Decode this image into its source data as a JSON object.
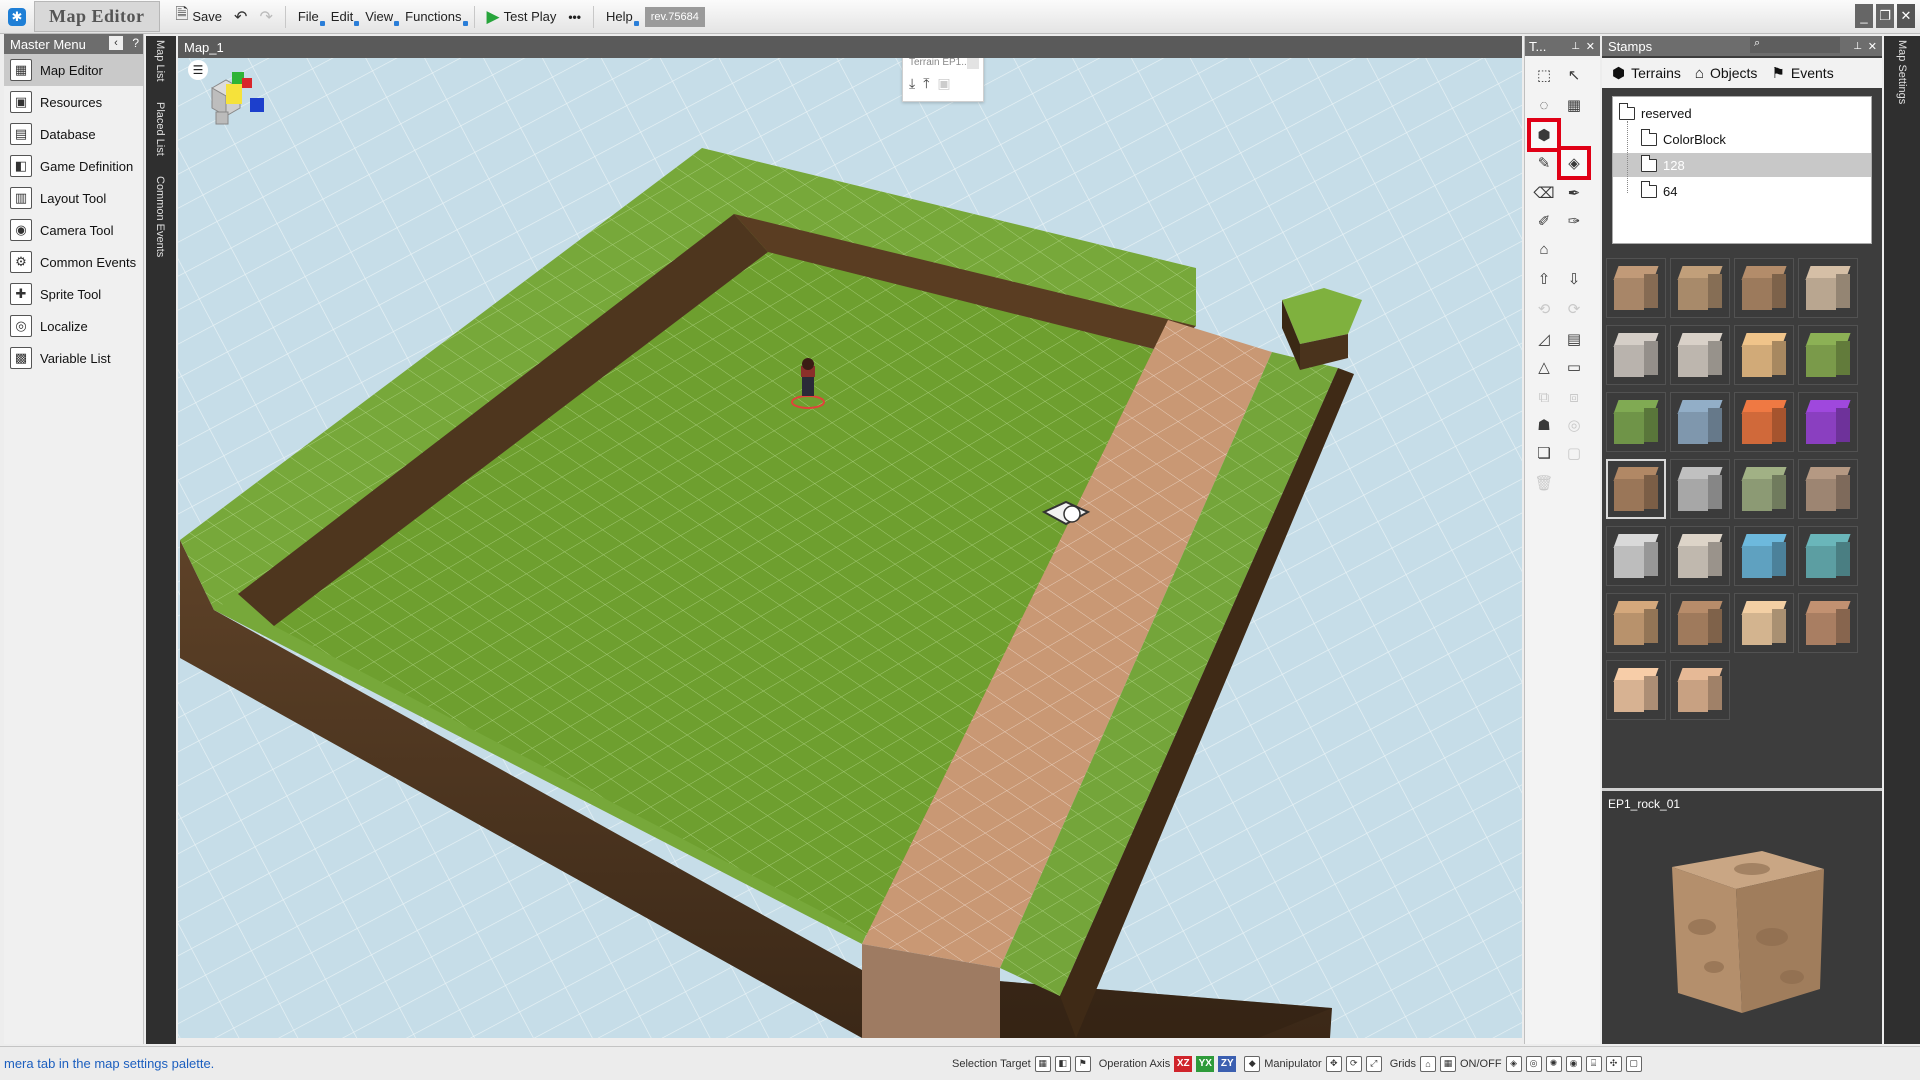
{
  "titlebar": {
    "app_title": "Map Editor",
    "save_label": "Save",
    "menus": [
      "File",
      "Edit",
      "View",
      "Functions"
    ],
    "test_play_label": "Test Play",
    "more_label": "•••",
    "help_label": "Help",
    "revision": "rev.75684"
  },
  "master_menu": {
    "title": "Master Menu",
    "help_label": "?",
    "items": [
      {
        "label": "Map Editor",
        "icon": "map-icon",
        "active": true
      },
      {
        "label": "Resources",
        "icon": "resources-icon"
      },
      {
        "label": "Database",
        "icon": "database-icon"
      },
      {
        "label": "Game Definition",
        "icon": "game-definition-icon"
      },
      {
        "label": "Layout Tool",
        "icon": "layout-icon"
      },
      {
        "label": "Camera Tool",
        "icon": "camera-icon"
      },
      {
        "label": "Common Events",
        "icon": "events-icon"
      },
      {
        "label": "Sprite Tool",
        "icon": "sprite-icon"
      },
      {
        "label": "Localize",
        "icon": "localize-icon"
      },
      {
        "label": "Variable List",
        "icon": "variable-icon"
      }
    ]
  },
  "side_tabs": [
    "Map List",
    "Placed List",
    "Common Events"
  ],
  "viewport": {
    "tab_label": "Map_1",
    "terrain_popup_title": "Terrain EP1..."
  },
  "tools_panel": {
    "title": "T...",
    "pin": "📌",
    "close": "✕"
  },
  "stamps": {
    "title": "Stamps",
    "tabs": [
      {
        "label": "Terrains",
        "icon": "terrain-icon"
      },
      {
        "label": "Objects",
        "icon": "objects-icon"
      },
      {
        "label": "Events",
        "icon": "events-icon"
      }
    ],
    "tree": [
      {
        "label": "reserved",
        "level": 0
      },
      {
        "label": "ColorBlock",
        "level": 1
      },
      {
        "label": "128",
        "level": 1,
        "selected": true
      },
      {
        "label": "64",
        "level": 1
      }
    ],
    "preview_name": "EP1_rock_01",
    "swatches": [
      "#a88668",
      "#a88a6a",
      "#9c7a5c",
      "#b9a690",
      "#b9b3ad",
      "#bdb6ae",
      "#d1aa78",
      "#7a9a4a",
      "#6f9448",
      "#7f97ad",
      "#d0693a",
      "#8a3fc0",
      "#9a7658",
      "#a7a7a7",
      "#8c9a74",
      "#9d8572",
      "#bdbdbd",
      "#c0b8ae",
      "#5fa1c0",
      "#5c9ea2",
      "#b8926c",
      "#9f7a5c",
      "#d3b48f",
      "#a97e62",
      "#d7b292",
      "#c8a182"
    ],
    "selected_swatch": 12
  },
  "right_strip_label": "Map Settings",
  "statusbar": {
    "message": "mera tab in the map settings palette.",
    "selection_target_label": "Selection Target",
    "operation_axis_label": "Operation Axis",
    "axes": [
      {
        "label": "XZ",
        "color": "#d0242b"
      },
      {
        "label": "YX",
        "color": "#2e9b3a"
      },
      {
        "label": "ZY",
        "color": "#3b5fb0"
      }
    ],
    "manipulator_label": "Manipulator",
    "grids_label": "Grids",
    "onoff_label": "ON/OFF"
  }
}
